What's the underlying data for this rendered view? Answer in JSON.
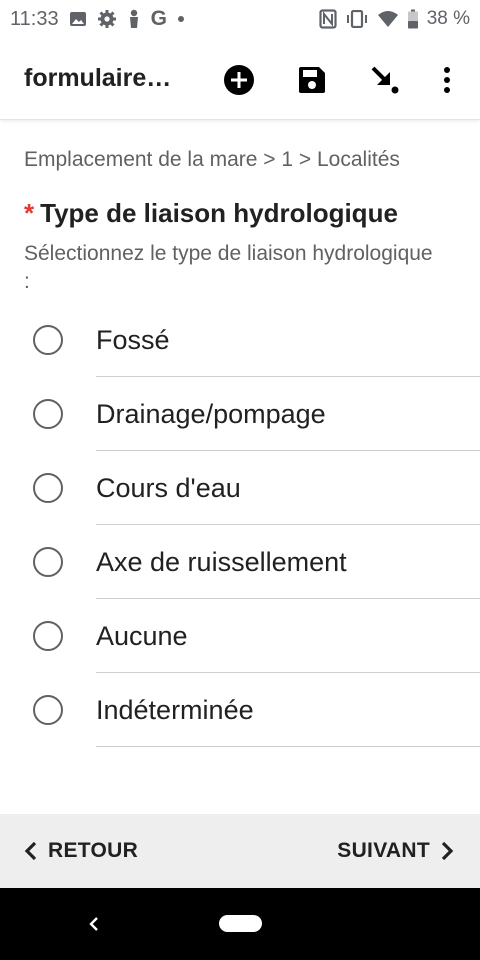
{
  "status_bar": {
    "time": "11:33",
    "battery": "38 %",
    "icons_left": [
      "image-icon",
      "gear-icon",
      "person-icon",
      "google-icon",
      "dot-icon"
    ],
    "icons_right": [
      "nfc-icon",
      "vibrate-icon",
      "wifi-icon",
      "battery-icon"
    ]
  },
  "app_bar": {
    "title": "formulaire…",
    "actions": [
      "add-circle-icon",
      "save-icon",
      "download-arrow-icon",
      "more-vert-icon"
    ]
  },
  "breadcrumb": "Emplacement de la mare > 1 > Localités",
  "question": {
    "required_marker": "*",
    "label": "Type de liaison hydrologique",
    "hint": "Sélectionnez le type de liaison hydrologique :"
  },
  "options": [
    {
      "label": "Fossé",
      "selected": false
    },
    {
      "label": "Drainage/pompage",
      "selected": false
    },
    {
      "label": "Cours d'eau",
      "selected": false
    },
    {
      "label": "Axe de ruissellement",
      "selected": false
    },
    {
      "label": "Aucune",
      "selected": false
    },
    {
      "label": "Indéterminée",
      "selected": false
    }
  ],
  "navigation": {
    "back_label": "RETOUR",
    "next_label": "SUIVANT"
  },
  "colors": {
    "required": "#e53935",
    "nav_background": "#eeeeee",
    "system_bar": "#000000"
  }
}
